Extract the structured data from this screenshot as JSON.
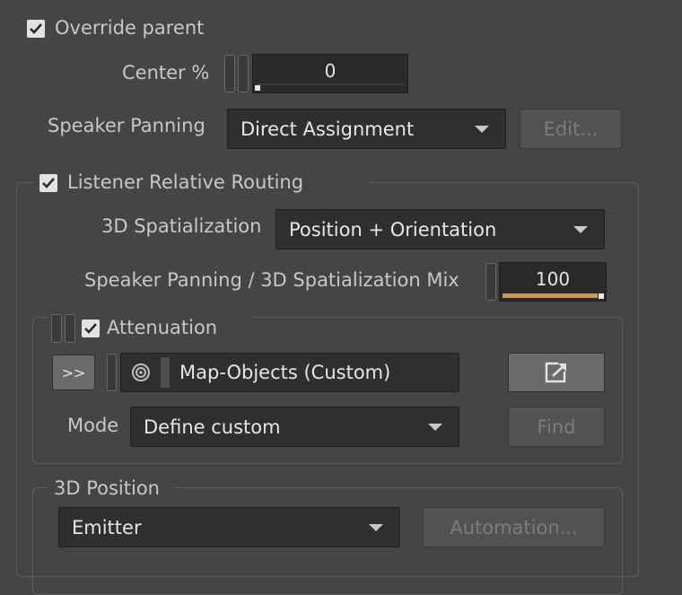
{
  "override_parent": {
    "label": "Override parent",
    "checked": true
  },
  "center": {
    "label": "Center %",
    "value": "0"
  },
  "speaker_panning": {
    "label": "Speaker Panning",
    "selected": "Direct Assignment",
    "edit_label": "Edit..."
  },
  "listener_routing": {
    "label": "Listener Relative Routing",
    "checked": true
  },
  "spatialization": {
    "label": "3D Spatialization",
    "selected": "Position + Orientation"
  },
  "mix": {
    "label": "Speaker Panning / 3D Spatialization Mix",
    "value": "100",
    "fill_percent": 100
  },
  "attenuation": {
    "label": "Attenuation",
    "checked": true,
    "expand_label": ">>",
    "object": "Map-Objects (Custom)",
    "mode_label": "Mode",
    "mode_selected": "Define custom",
    "find_label": "Find"
  },
  "position_3d": {
    "label": "3D Position",
    "selected": "Emitter",
    "automation_label": "Automation..."
  },
  "colors": {
    "accent": "#d8964a",
    "background": "#454545",
    "field": "#2f2f2f"
  }
}
